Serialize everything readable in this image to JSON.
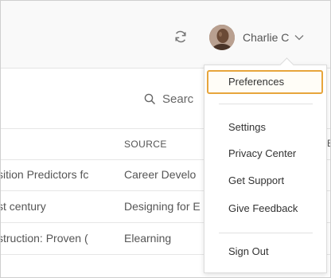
{
  "header": {
    "user_name": "Charlie C"
  },
  "search": {
    "placeholder": "Searc"
  },
  "table": {
    "headers": [
      "SOURCE",
      "E"
    ],
    "rows": [
      {
        "title": "sition Predictors fc",
        "source": "Career Develo"
      },
      {
        "title": "st century",
        "source": "Designing for E"
      },
      {
        "title": "struction: Proven (",
        "source": "Elearning"
      }
    ]
  },
  "user_menu": {
    "items": [
      "Preferences",
      "Settings",
      "Privacy Center",
      "Get Support",
      "Give Feedback",
      "Sign Out"
    ],
    "highlighted": "Preferences"
  },
  "colors": {
    "highlight_border": "#e7a53c"
  }
}
